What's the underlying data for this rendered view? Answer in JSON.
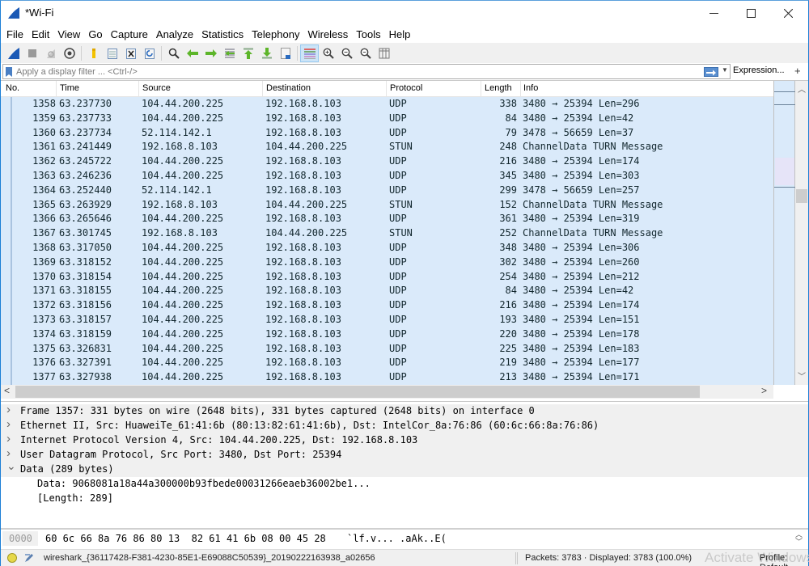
{
  "window": {
    "title": "*Wi-Fi",
    "controls": {
      "minimize": "—",
      "maximize": "☐",
      "close": "✕"
    }
  },
  "menu": [
    "File",
    "Edit",
    "View",
    "Go",
    "Capture",
    "Analyze",
    "Statistics",
    "Telephony",
    "Wireless",
    "Tools",
    "Help"
  ],
  "toolbar": {
    "buttons": [
      {
        "name": "start-capture-icon"
      },
      {
        "name": "stop-capture-icon"
      },
      {
        "name": "restart-capture-icon"
      },
      {
        "name": "capture-options-icon"
      },
      {
        "name": "open-file-icon"
      },
      {
        "name": "save-file-icon"
      },
      {
        "name": "close-file-icon"
      },
      {
        "name": "reload-file-icon"
      },
      {
        "name": "find-packet-icon"
      },
      {
        "name": "go-back-icon"
      },
      {
        "name": "go-forward-icon"
      },
      {
        "name": "go-to-packet-icon"
      },
      {
        "name": "go-first-packet-icon"
      },
      {
        "name": "go-last-packet-icon"
      },
      {
        "name": "autoscroll-icon"
      },
      {
        "name": "colorize-icon"
      },
      {
        "name": "zoom-in-icon"
      },
      {
        "name": "zoom-out-icon"
      },
      {
        "name": "normal-size-icon"
      },
      {
        "name": "resize-columns-icon"
      }
    ]
  },
  "filter": {
    "placeholder": "Apply a display filter ... <Ctrl-/>",
    "value": "",
    "expression_label": "Expression...",
    "add_label": "+"
  },
  "packet_list": {
    "columns": [
      "No.",
      "Time",
      "Source",
      "Destination",
      "Protocol",
      "Length",
      "Info"
    ],
    "rows": [
      {
        "no": "1358",
        "time": "63.237730",
        "src": "104.44.200.225",
        "dst": "192.168.8.103",
        "proto": "UDP",
        "len": "338",
        "info": "3480 → 25394 Len=296"
      },
      {
        "no": "1359",
        "time": "63.237733",
        "src": "104.44.200.225",
        "dst": "192.168.8.103",
        "proto": "UDP",
        "len": "84",
        "info": "3480 → 25394 Len=42"
      },
      {
        "no": "1360",
        "time": "63.237734",
        "src": "52.114.142.1",
        "dst": "192.168.8.103",
        "proto": "UDP",
        "len": "79",
        "info": "3478 → 56659 Len=37"
      },
      {
        "no": "1361",
        "time": "63.241449",
        "src": "192.168.8.103",
        "dst": "104.44.200.225",
        "proto": "STUN",
        "len": "248",
        "info": "ChannelData TURN Message"
      },
      {
        "no": "1362",
        "time": "63.245722",
        "src": "104.44.200.225",
        "dst": "192.168.8.103",
        "proto": "UDP",
        "len": "216",
        "info": "3480 → 25394 Len=174"
      },
      {
        "no": "1363",
        "time": "63.246236",
        "src": "104.44.200.225",
        "dst": "192.168.8.103",
        "proto": "UDP",
        "len": "345",
        "info": "3480 → 25394 Len=303"
      },
      {
        "no": "1364",
        "time": "63.252440",
        "src": "52.114.142.1",
        "dst": "192.168.8.103",
        "proto": "UDP",
        "len": "299",
        "info": "3478 → 56659 Len=257"
      },
      {
        "no": "1365",
        "time": "63.263929",
        "src": "192.168.8.103",
        "dst": "104.44.200.225",
        "proto": "STUN",
        "len": "152",
        "info": "ChannelData TURN Message"
      },
      {
        "no": "1366",
        "time": "63.265646",
        "src": "104.44.200.225",
        "dst": "192.168.8.103",
        "proto": "UDP",
        "len": "361",
        "info": "3480 → 25394 Len=319"
      },
      {
        "no": "1367",
        "time": "63.301745",
        "src": "192.168.8.103",
        "dst": "104.44.200.225",
        "proto": "STUN",
        "len": "252",
        "info": "ChannelData TURN Message"
      },
      {
        "no": "1368",
        "time": "63.317050",
        "src": "104.44.200.225",
        "dst": "192.168.8.103",
        "proto": "UDP",
        "len": "348",
        "info": "3480 → 25394 Len=306"
      },
      {
        "no": "1369",
        "time": "63.318152",
        "src": "104.44.200.225",
        "dst": "192.168.8.103",
        "proto": "UDP",
        "len": "302",
        "info": "3480 → 25394 Len=260"
      },
      {
        "no": "1370",
        "time": "63.318154",
        "src": "104.44.200.225",
        "dst": "192.168.8.103",
        "proto": "UDP",
        "len": "254",
        "info": "3480 → 25394 Len=212"
      },
      {
        "no": "1371",
        "time": "63.318155",
        "src": "104.44.200.225",
        "dst": "192.168.8.103",
        "proto": "UDP",
        "len": "84",
        "info": "3480 → 25394 Len=42"
      },
      {
        "no": "1372",
        "time": "63.318156",
        "src": "104.44.200.225",
        "dst": "192.168.8.103",
        "proto": "UDP",
        "len": "216",
        "info": "3480 → 25394 Len=174"
      },
      {
        "no": "1373",
        "time": "63.318157",
        "src": "104.44.200.225",
        "dst": "192.168.8.103",
        "proto": "UDP",
        "len": "193",
        "info": "3480 → 25394 Len=151"
      },
      {
        "no": "1374",
        "time": "63.318159",
        "src": "104.44.200.225",
        "dst": "192.168.8.103",
        "proto": "UDP",
        "len": "220",
        "info": "3480 → 25394 Len=178"
      },
      {
        "no": "1375",
        "time": "63.326831",
        "src": "104.44.200.225",
        "dst": "192.168.8.103",
        "proto": "UDP",
        "len": "225",
        "info": "3480 → 25394 Len=183"
      },
      {
        "no": "1376",
        "time": "63.327391",
        "src": "104.44.200.225",
        "dst": "192.168.8.103",
        "proto": "UDP",
        "len": "219",
        "info": "3480 → 25394 Len=177"
      },
      {
        "no": "1377",
        "time": "63.327938",
        "src": "104.44.200.225",
        "dst": "192.168.8.103",
        "proto": "UDP",
        "len": "213",
        "info": "3480 → 25394 Len=171"
      }
    ],
    "row_color": "#daeafa"
  },
  "details": [
    {
      "expanded": false,
      "indent": 0,
      "text": "Frame 1357: 331 bytes on wire (2648 bits), 331 bytes captured (2648 bits) on interface 0"
    },
    {
      "expanded": false,
      "indent": 0,
      "text": "Ethernet II, Src: HuaweiTe_61:41:6b (80:13:82:61:41:6b), Dst: IntelCor_8a:76:86 (60:6c:66:8a:76:86)"
    },
    {
      "expanded": false,
      "indent": 0,
      "text": "Internet Protocol Version 4, Src: 104.44.200.225, Dst: 192.168.8.103"
    },
    {
      "expanded": false,
      "indent": 0,
      "text": "User Datagram Protocol, Src Port: 3480, Dst Port: 25394"
    },
    {
      "expanded": true,
      "indent": 0,
      "text": "Data (289 bytes)"
    },
    {
      "expanded": null,
      "indent": 1,
      "text": "Data: 9068081a18a44a300000b93fbede00031266eaeb36002be1..."
    },
    {
      "expanded": null,
      "indent": 1,
      "text": "[Length: 289]"
    }
  ],
  "bytes": {
    "offset": "0000",
    "hex": "60 6c 66 8a 76 86 80 13  82 61 41 6b 08 00 45 28",
    "ascii": "`lf.v... .aAk..E("
  },
  "status": {
    "file": "wireshark_{36117428-F381-4230-85E1-E69088C50539}_20190222163938_a02656",
    "packets": "Packets: 3783 · Displayed: 3783 (100.0%)",
    "watermark": "Activate Windows",
    "profile": "Profile: Default"
  }
}
